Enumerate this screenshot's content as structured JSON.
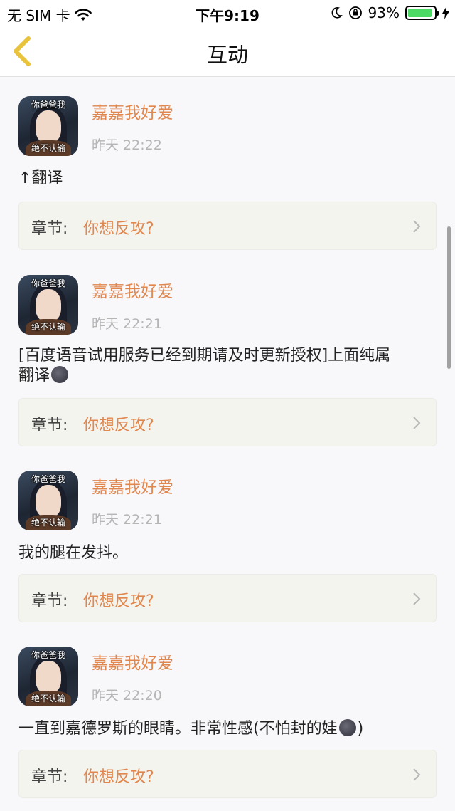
{
  "status_bar": {
    "carrier": "无 SIM 卡",
    "time": "下午9:19",
    "battery_percent": "93%",
    "battery_level": 0.93
  },
  "nav": {
    "title": "互动"
  },
  "posts": [
    {
      "avatar_caption_top": "你爸爸我",
      "avatar_caption_bottom": "绝不认输",
      "username": "嘉嘉我好爱",
      "time": "昨天 22:22",
      "text": "↑翻译",
      "chapter_label": "章节:",
      "chapter_name": "你想反攻?"
    },
    {
      "avatar_caption_top": "你爸爸我",
      "avatar_caption_bottom": "绝不认输",
      "username": "嘉嘉我好爱",
      "time": "昨天 22:21",
      "text_line1": "[百度语音试用服务已经到期请及时更新授权]上面纯属",
      "text_line2": "翻译",
      "chapter_label": "章节:",
      "chapter_name": "你想反攻?"
    },
    {
      "avatar_caption_top": "你爸爸我",
      "avatar_caption_bottom": "绝不认输",
      "username": "嘉嘉我好爱",
      "time": "昨天 22:21",
      "text": "我的腿在发抖。",
      "chapter_label": "章节:",
      "chapter_name": "你想反攻?"
    },
    {
      "avatar_caption_top": "你爸爸我",
      "avatar_caption_bottom": "绝不认输",
      "username": "嘉嘉我好爱",
      "time": "昨天 22:20",
      "text_before_emoji": "一直到嘉德罗斯的眼睛。非常性感(不怕封的娃",
      "text_after_emoji": ")",
      "chapter_label": "章节:",
      "chapter_name": "你想反攻?"
    }
  ],
  "colors": {
    "accent": "#e0874f",
    "muted": "#b5b5b5",
    "card": "#f4f4ef"
  }
}
